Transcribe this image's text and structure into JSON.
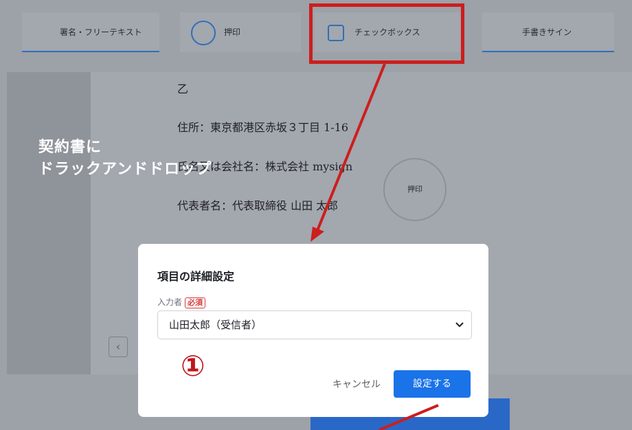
{
  "toolbar": {
    "signature_text": "署名・フリーテキスト",
    "stamp": "押印",
    "checkbox": "チェックボックス",
    "handwritten": "手書きサイン"
  },
  "contract": {
    "party": "乙",
    "address": "住所：東京都港区赤坂３丁目 1-16",
    "company": "氏名又は会社名：株式会社 mysign",
    "representative": "代表者名：代表取締役 山田 太郎",
    "stamp_label": "押印"
  },
  "annotation": {
    "line1": "契約書に",
    "line2": "ドラックアンドドロップ",
    "step_marker": "①"
  },
  "modal": {
    "title": "項目の詳細設定",
    "field_label": "入力者",
    "required_badge": "必須",
    "selected_value": "山田太郎（受信者）",
    "cancel_label": "キャンセル",
    "submit_label": "設定する"
  },
  "pagination": {
    "prev_icon": "‹"
  },
  "colors": {
    "accent": "#1a73e8",
    "annotation_red": "#cc1e1e",
    "required_red": "#d83a3a"
  }
}
